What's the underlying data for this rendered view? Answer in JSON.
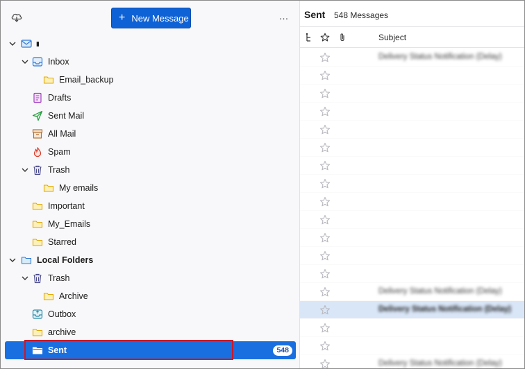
{
  "toolbar": {
    "new_message_label": "New Message",
    "more_label": "…"
  },
  "folders": {
    "account_name": "▮",
    "inbox": "Inbox",
    "email_backup": "Email_backup",
    "drafts": "Drafts",
    "sent_mail": "Sent Mail",
    "all_mail": "All Mail",
    "spam": "Spam",
    "trash": "Trash",
    "my_emails": "My emails",
    "important": "Important",
    "my_emails2": "My_Emails",
    "starred": "Starred",
    "local_folders": "Local Folders",
    "local_trash": "Trash",
    "archive": "Archive",
    "outbox": "Outbox",
    "archive_lower": "archive",
    "sent": "Sent",
    "sent_count": "548"
  },
  "message_list": {
    "folder_title": "Sent",
    "count_text": "548 Messages",
    "subject_header": "Subject",
    "rows": [
      {
        "subject": "Delivery Status Notification (Delay)",
        "bold": false,
        "highlight": false
      },
      {
        "subject": "",
        "bold": false,
        "highlight": false
      },
      {
        "subject": "",
        "bold": false,
        "highlight": false
      },
      {
        "subject": "",
        "bold": false,
        "highlight": false
      },
      {
        "subject": "",
        "bold": false,
        "highlight": false
      },
      {
        "subject": "",
        "bold": false,
        "highlight": false
      },
      {
        "subject": "",
        "bold": false,
        "highlight": false
      },
      {
        "subject": "",
        "bold": false,
        "highlight": false
      },
      {
        "subject": "",
        "bold": false,
        "highlight": false
      },
      {
        "subject": "",
        "bold": false,
        "highlight": false
      },
      {
        "subject": "",
        "bold": false,
        "highlight": false
      },
      {
        "subject": "",
        "bold": false,
        "highlight": false
      },
      {
        "subject": "",
        "bold": false,
        "highlight": false
      },
      {
        "subject": "Delivery Status Notification (Delay)",
        "bold": false,
        "highlight": false
      },
      {
        "subject": "Delivery Status Notification (Delay)",
        "bold": true,
        "highlight": true
      },
      {
        "subject": "",
        "bold": false,
        "highlight": false
      },
      {
        "subject": "",
        "bold": false,
        "highlight": false
      },
      {
        "subject": "Delivery Status Notification (Delay)",
        "bold": false,
        "highlight": false
      }
    ]
  },
  "colors": {
    "accent": "#0f62d6",
    "selected_row": "#1a6fe0",
    "selection_outline": "#c8192b",
    "highlight_row": "#d9e6f7"
  }
}
